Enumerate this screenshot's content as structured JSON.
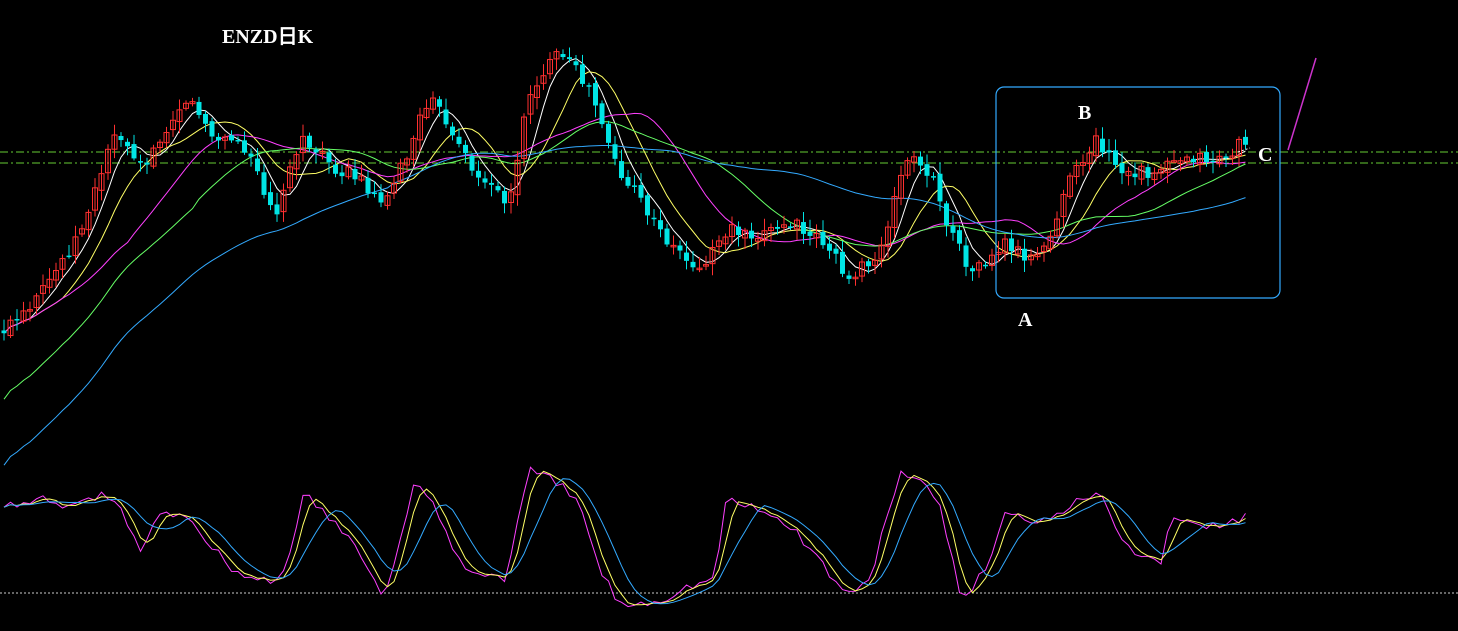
{
  "chart_data": {
    "type": "candlestick",
    "title": "ENZD日K",
    "annotations": [
      "A",
      "B",
      "C"
    ],
    "colors": {
      "background": "#000000",
      "up": "#ff3030",
      "down": "#00e5e5",
      "ma_fast": "#ffffff",
      "ma_mid": "#ffff66",
      "ma_slow": "#ff40ff",
      "ma_longer": "#66ff66",
      "ma_longest": "#33aaff",
      "reference_line": "#66cc33",
      "highlight_box": "#33aaff",
      "trend_line": "#cc33cc",
      "osc_fast": "#ff40ff",
      "osc_mid": "#ffff66",
      "osc_slow": "#33aaff",
      "osc_baseline": "#cccccc"
    },
    "moving_averages": [
      "ma_fast",
      "ma_mid",
      "ma_slow",
      "ma_longer",
      "ma_longest"
    ],
    "oscillator_lines": [
      "osc_fast",
      "osc_mid",
      "osc_slow"
    ],
    "highlight_box": true,
    "grid": false
  }
}
